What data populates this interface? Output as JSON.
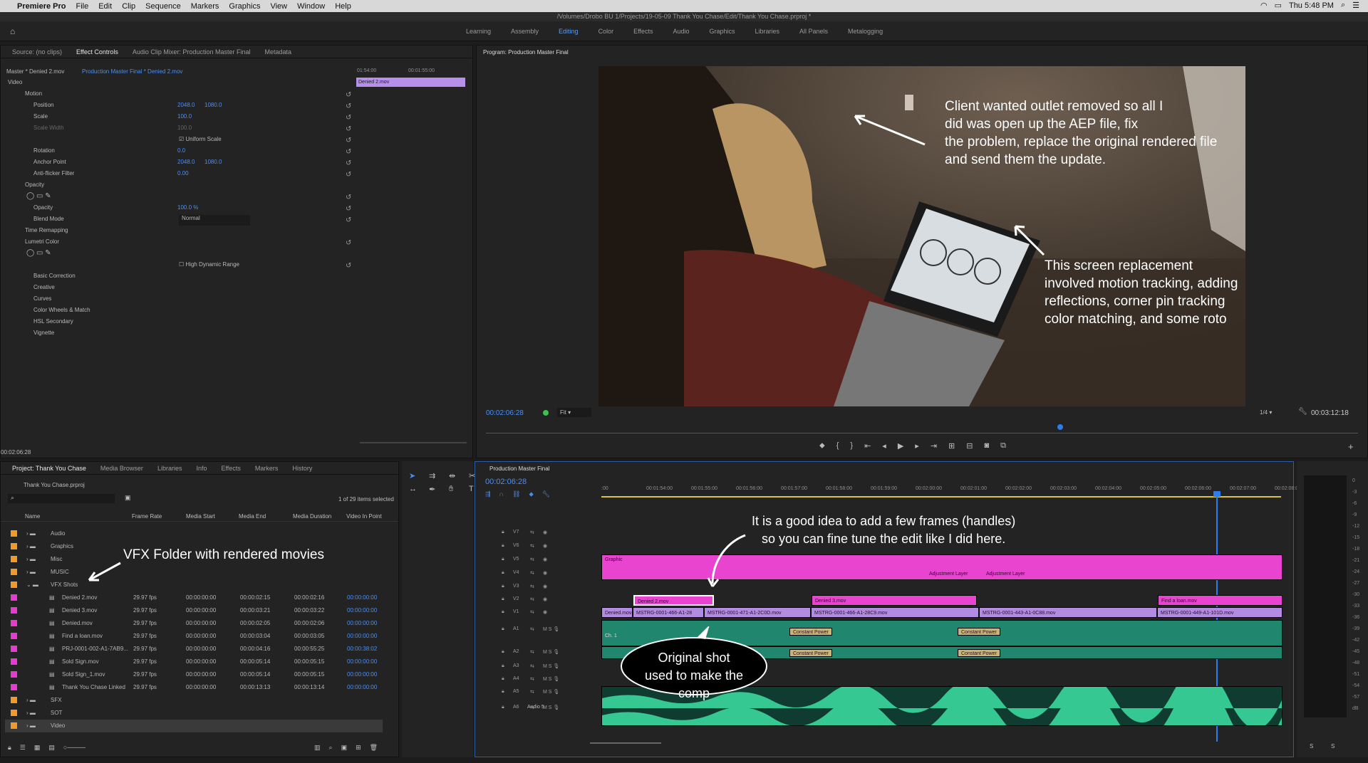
{
  "menubar": {
    "app": "Premiere Pro",
    "items": [
      "File",
      "Edit",
      "Clip",
      "Sequence",
      "Markers",
      "Graphics",
      "View",
      "Window",
      "Help"
    ],
    "clock": "Thu 5:48 PM"
  },
  "title": "/Volumes/Drobo BU 1/Projects/19-05-09 Thank You Chase/Edit/Thank You Chase.prproj *",
  "workspaces": [
    "Learning",
    "Assembly",
    "Editing",
    "Color",
    "Effects",
    "Audio",
    "Graphics",
    "Libraries",
    "All Panels",
    "Metalogging"
  ],
  "source_panel": {
    "tabs": [
      "Source: (no clips)",
      "Effect Controls",
      "Audio Clip Mixer: Production Master Final",
      "Metadata"
    ],
    "master": "Master * Denied 2.mov",
    "sequence_link": "Production Master Final * Denied 2.mov",
    "time1": "01:54:00",
    "time2": "00:01:55:00",
    "clip_label": "Denied 2.mov",
    "video_header": "Video",
    "motion": "Motion",
    "position_label": "Position",
    "position_x": "2048.0",
    "position_y": "1080.0",
    "scale_label": "Scale",
    "scale_val": "100.0",
    "scale_width_label": "Scale Width",
    "scale_width_val": "100.0",
    "uniform_scale": "Uniform Scale",
    "rotation_label": "Rotation",
    "rotation_val": "0.0",
    "anchor_label": "Anchor Point",
    "anchor_x": "2048.0",
    "anchor_y": "1080.0",
    "antiflicker_label": "Anti-flicker Filter",
    "antiflicker_val": "0.00",
    "opacity_group": "Opacity",
    "opacity_label": "Opacity",
    "opacity_val": "100.0 %",
    "blend_label": "Blend Mode",
    "blend_val": "Normal",
    "time_remap": "Time Remapping",
    "lumetri": "Lumetri Color",
    "hdr": "High Dynamic Range",
    "lumetri_items": [
      "Basic Correction",
      "Creative",
      "Curves",
      "Color Wheels & Match",
      "HSL Secondary",
      "Vignette"
    ],
    "timecode": "00:02:06:28"
  },
  "program_panel": {
    "title": "Program: Production Master Final",
    "timecode": "00:02:06:28",
    "fit": "Fit",
    "zoom": "1/4",
    "duration": "00:03:12:18"
  },
  "annotations": {
    "outlet": "Client wanted outlet removed so all I\ndid was open up the AEP file, fix\nthe problem, replace the original rendered file\nand send them the update.",
    "screen": "This screen replacement\ninvolved motion tracking, adding\nreflections, corner pin tracking\ncolor matching, and some roto",
    "vfx": "VFX Folder with rendered movies",
    "handles": "It is a good idea to add a few frames (handles)\nso you can fine tune the edit like I did here.",
    "original": "Original shot\nused to make the\ncomp"
  },
  "project_panel": {
    "tabs": [
      "Project: Thank You Chase",
      "Media Browser",
      "Libraries",
      "Info",
      "Effects",
      "Markers",
      "History"
    ],
    "project_file": "Thank You Chase.prproj",
    "selection": "1 of 29 items selected",
    "columns": [
      "Name",
      "Frame Rate",
      "Media Start",
      "Media End",
      "Media Duration",
      "Video In Point"
    ],
    "folders": [
      "Audio",
      "Graphics",
      "Misc",
      "MUSIC",
      "VFX Shots"
    ],
    "items": [
      {
        "name": "Denied 2.mov",
        "fps": "29.97 fps",
        "start": "00:00:00:00",
        "end": "00:00:02:15",
        "dur": "00:00:02:16",
        "in": "00:00:00:00"
      },
      {
        "name": "Denied 3.mov",
        "fps": "29.97 fps",
        "start": "00:00:00:00",
        "end": "00:00:03:21",
        "dur": "00:00:03:22",
        "in": "00:00:00:00"
      },
      {
        "name": "Denied.mov",
        "fps": "29.97 fps",
        "start": "00:00:00:00",
        "end": "00:00:02:05",
        "dur": "00:00:02:06",
        "in": "00:00:00:00"
      },
      {
        "name": "Find a loan.mov",
        "fps": "29.97 fps",
        "start": "00:00:00:00",
        "end": "00:00:03:04",
        "dur": "00:00:03:05",
        "in": "00:00:00:00"
      },
      {
        "name": "PRJ-0001-002-A1-7AB9...",
        "fps": "29.97 fps",
        "start": "00:00:00:00",
        "end": "00:00:04:16",
        "dur": "00:00:55:25",
        "in": "00:00:38:02"
      },
      {
        "name": "Sold Sign.mov",
        "fps": "29.97 fps",
        "start": "00:00:00:00",
        "end": "00:00:05:14",
        "dur": "00:00:05:15",
        "in": "00:00:00:00"
      },
      {
        "name": "Sold Sign_1.mov",
        "fps": "29.97 fps",
        "start": "00:00:00:00",
        "end": "00:00:05:14",
        "dur": "00:00:05:15",
        "in": "00:00:00:00"
      },
      {
        "name": "Thank You Chase Linked",
        "fps": "29.97 fps",
        "start": "00:00:00:00",
        "end": "00:00:13:13",
        "dur": "00:00:13:14",
        "in": "00:00:00:00"
      }
    ],
    "folders_after": [
      "SFX",
      "SOT",
      "Video"
    ]
  },
  "timeline": {
    "title": "Production Master Final",
    "timecode": "00:02:06:28",
    "ruler": [
      ":00",
      "00:01:54:00",
      "00:01:55:00",
      "00:01:56:00",
      "00:01:57:00",
      "00:01:58:00",
      "00:01:59:00",
      "00:02:00:00",
      "00:02:01:00",
      "00:02:02:00",
      "00:02:03:00",
      "00:02:04:00",
      "00:02:05:00",
      "00:02:06:00",
      "00:02:07:00",
      "00:02:08:00"
    ],
    "tracks": [
      "V7",
      "V6",
      "V5",
      "V4",
      "V3",
      "V2",
      "V1",
      "A1",
      "A2",
      "A3",
      "A4",
      "A5",
      "A6"
    ],
    "audio5_label": "Audio 5",
    "clips": {
      "graphic": "Graphic",
      "adj1": "Adjustment Layer",
      "adj2": "Adjustment Layer",
      "denied2": "Denied 2.mov",
      "denied3": "Denied 3.mov",
      "findloan": "Find a loan.mov",
      "deniedv1": "Denied.mov",
      "m1": "MSTRG-0001-466-A1-28",
      "m2": "MSTRG-0001-471-A1-2C0D.mov",
      "m3": "MSTRG-0001-466-A1-28C9.mov",
      "m4": "MSTRG-0001-443-A1-0C88.mov",
      "m5": "MSTRG-0001-449-A1-101D.mov",
      "cp": "Constant Power",
      "ch1": "Ch. 1"
    }
  },
  "meter_scale": [
    "0",
    "-3",
    "-6",
    "-9",
    "-12",
    "-15",
    "-18",
    "-21",
    "-24",
    "-27",
    "-30",
    "-33",
    "-36",
    "-39",
    "-42",
    "-45",
    "-48",
    "-51",
    "-54",
    "-57",
    "dB"
  ],
  "meter_bottom": [
    "S",
    "S"
  ]
}
